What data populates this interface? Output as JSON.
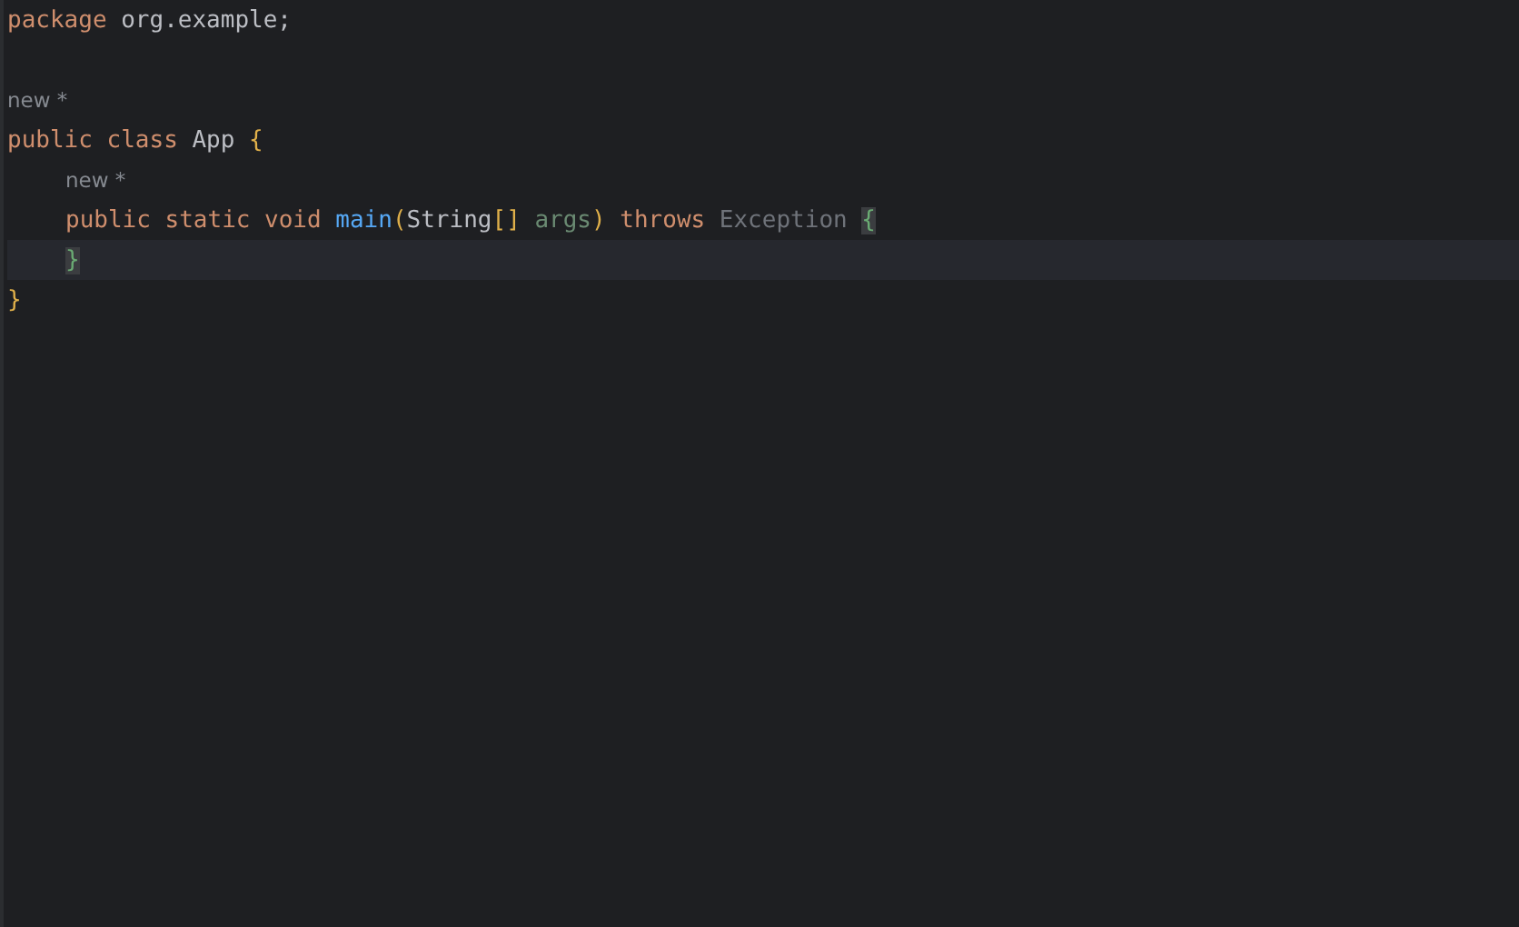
{
  "editor": {
    "lines": [
      {
        "kind": "code",
        "indented": false,
        "current": false,
        "tokens": [
          {
            "kind": "keyword",
            "text": "package"
          },
          {
            "kind": "plain",
            "text": "org.example;"
          }
        ]
      },
      {
        "kind": "blank",
        "current": false
      },
      {
        "kind": "inlay",
        "indented": false,
        "current": false,
        "text": "new *"
      },
      {
        "kind": "code",
        "indented": false,
        "current": false,
        "tokens": [
          {
            "kind": "keyword",
            "text": "public"
          },
          {
            "kind": "keyword",
            "text": "class"
          },
          {
            "kind": "plain",
            "text": "App"
          },
          {
            "kind": "bracket",
            "text": "{"
          }
        ]
      },
      {
        "kind": "inlay",
        "indented": true,
        "current": false,
        "text": "new *"
      },
      {
        "kind": "code",
        "indented": true,
        "current": false,
        "tokens": [
          {
            "kind": "keyword",
            "text": "public"
          },
          {
            "kind": "keyword",
            "text": "static"
          },
          {
            "kind": "keyword",
            "text": "void"
          },
          {
            "kind": "function",
            "text": "main"
          },
          {
            "kind": "bracket",
            "text": "(",
            "join": true
          },
          {
            "kind": "plain",
            "text": "String",
            "join": true
          },
          {
            "kind": "bracket",
            "text": "[]",
            "join": true
          },
          {
            "kind": "unused",
            "text": "args",
            "join": false
          },
          {
            "kind": "bracket",
            "text": ")",
            "join": true
          },
          {
            "kind": "keyword",
            "text": "throws"
          },
          {
            "kind": "muted",
            "text": "Exception"
          },
          {
            "kind": "matched",
            "text": "{"
          }
        ]
      },
      {
        "kind": "code",
        "indented": true,
        "current": true,
        "tokens": [
          {
            "kind": "matched",
            "text": "}"
          }
        ]
      },
      {
        "kind": "code",
        "indented": false,
        "current": false,
        "tokens": [
          {
            "kind": "bracket",
            "text": "}"
          }
        ]
      }
    ]
  }
}
